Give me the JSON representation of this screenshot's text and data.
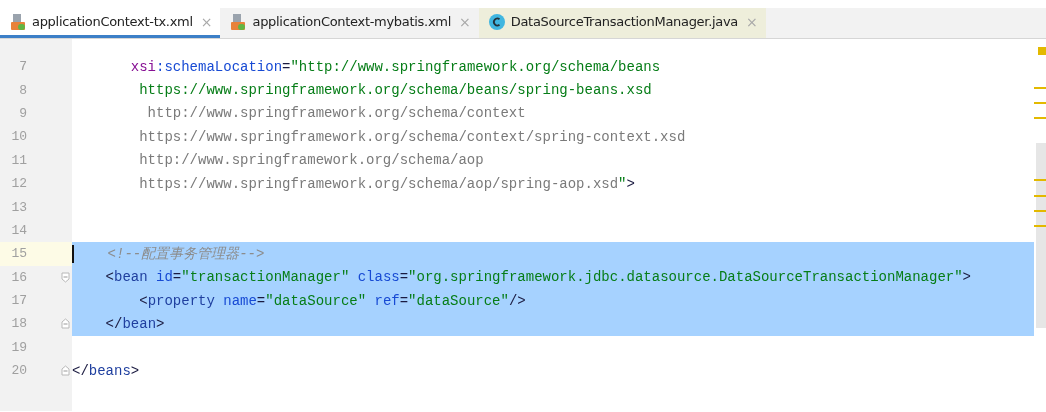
{
  "tabs": [
    {
      "label": "applicationContext-tx.xml",
      "kind": "xml",
      "selected": true,
      "close": "×"
    },
    {
      "label": "applicationContext-mybatis.xml",
      "kind": "xml",
      "selected": false,
      "close": "×"
    },
    {
      "label": "DataSourceTransactionManager.java",
      "kind": "java",
      "selected": false,
      "close": "×"
    }
  ],
  "editor": {
    "lines": [
      {
        "number": "7",
        "selected": false,
        "current": false,
        "fold_start": false,
        "fold_end": false,
        "tokens": [
          {
            "kind": "ns",
            "text": "       xsi"
          },
          {
            "kind": "attr",
            "text": ":schemaLocation"
          },
          {
            "kind": "punct",
            "text": "="
          },
          {
            "kind": "value",
            "text": "\"http://www.springframework.org/schema/beans"
          }
        ]
      },
      {
        "number": "8",
        "selected": false,
        "current": false,
        "fold_start": false,
        "fold_end": false,
        "tokens": [
          {
            "kind": "value",
            "text": "        https://www.springframework.org/schema/beans/spring-beans.xsd"
          }
        ]
      },
      {
        "number": "9",
        "selected": false,
        "current": false,
        "fold_start": false,
        "fold_end": false,
        "tokens": [
          {
            "kind": "url",
            "text": "         http://www.springframework.org/schema/context"
          }
        ]
      },
      {
        "number": "10",
        "selected": false,
        "current": false,
        "fold_start": false,
        "fold_end": false,
        "tokens": [
          {
            "kind": "url",
            "text": "        https://www.springframework.org/schema/context/spring-context.xsd"
          }
        ]
      },
      {
        "number": "11",
        "selected": false,
        "current": false,
        "fold_start": false,
        "fold_end": false,
        "tokens": [
          {
            "kind": "url",
            "text": "        http://www.springframework.org/schema/aop"
          }
        ]
      },
      {
        "number": "12",
        "selected": false,
        "current": false,
        "fold_start": false,
        "fold_end": false,
        "tokens": [
          {
            "kind": "url",
            "text": "        https://www.springframework.org/schema/aop/spring-aop.xsd"
          },
          {
            "kind": "value",
            "text": "\""
          },
          {
            "kind": "punct",
            "text": ">"
          }
        ]
      },
      {
        "number": "13",
        "selected": false,
        "current": false,
        "fold_start": false,
        "fold_end": false
      },
      {
        "number": "14",
        "selected": false,
        "current": false,
        "fold_start": false,
        "fold_end": false
      },
      {
        "number": "15",
        "selected": true,
        "current": true,
        "fold_start": false,
        "fold_end": false,
        "tokens": [
          {
            "kind": "comment",
            "text": "    <!--配置事务管理器-->"
          }
        ]
      },
      {
        "number": "16",
        "selected": true,
        "current": false,
        "fold_start": true,
        "fold_end": false,
        "tokens": [
          {
            "kind": "punct",
            "text": "    <"
          },
          {
            "kind": "tag",
            "text": "bean "
          },
          {
            "kind": "attr",
            "text": "id"
          },
          {
            "kind": "punct",
            "text": "="
          },
          {
            "kind": "value",
            "text": "\"transactionManager\" "
          },
          {
            "kind": "attr",
            "text": "class"
          },
          {
            "kind": "punct",
            "text": "="
          },
          {
            "kind": "value",
            "text": "\"org.springframework.jdbc.datasource.DataSourceTransactionManager\""
          },
          {
            "kind": "punct",
            "text": ">"
          }
        ]
      },
      {
        "number": "17",
        "selected": true,
        "current": false,
        "fold_start": false,
        "fold_end": false,
        "tokens": [
          {
            "kind": "punct",
            "text": "        <"
          },
          {
            "kind": "tag",
            "text": "property "
          },
          {
            "kind": "attr",
            "text": "name"
          },
          {
            "kind": "punct",
            "text": "="
          },
          {
            "kind": "value",
            "text": "\"dataSource\" "
          },
          {
            "kind": "attr",
            "text": "ref"
          },
          {
            "kind": "punct",
            "text": "="
          },
          {
            "kind": "value",
            "text": "\"dataSource\""
          },
          {
            "kind": "punct",
            "text": "/>"
          }
        ]
      },
      {
        "number": "18",
        "selected": true,
        "current": false,
        "fold_start": false,
        "fold_end": true,
        "tokens": [
          {
            "kind": "punct",
            "text": "    </"
          },
          {
            "kind": "tag",
            "text": "bean"
          },
          {
            "kind": "punct",
            "text": ">"
          }
        ]
      },
      {
        "number": "19",
        "selected": false,
        "current": false,
        "fold_start": false,
        "fold_end": false
      },
      {
        "number": "20",
        "selected": false,
        "current": false,
        "fold_start": false,
        "fold_end": true,
        "tokens": [
          {
            "kind": "punct",
            "text": "</"
          },
          {
            "kind": "tag",
            "text": "beans"
          },
          {
            "kind": "punct",
            "text": ">"
          }
        ]
      }
    ]
  }
}
